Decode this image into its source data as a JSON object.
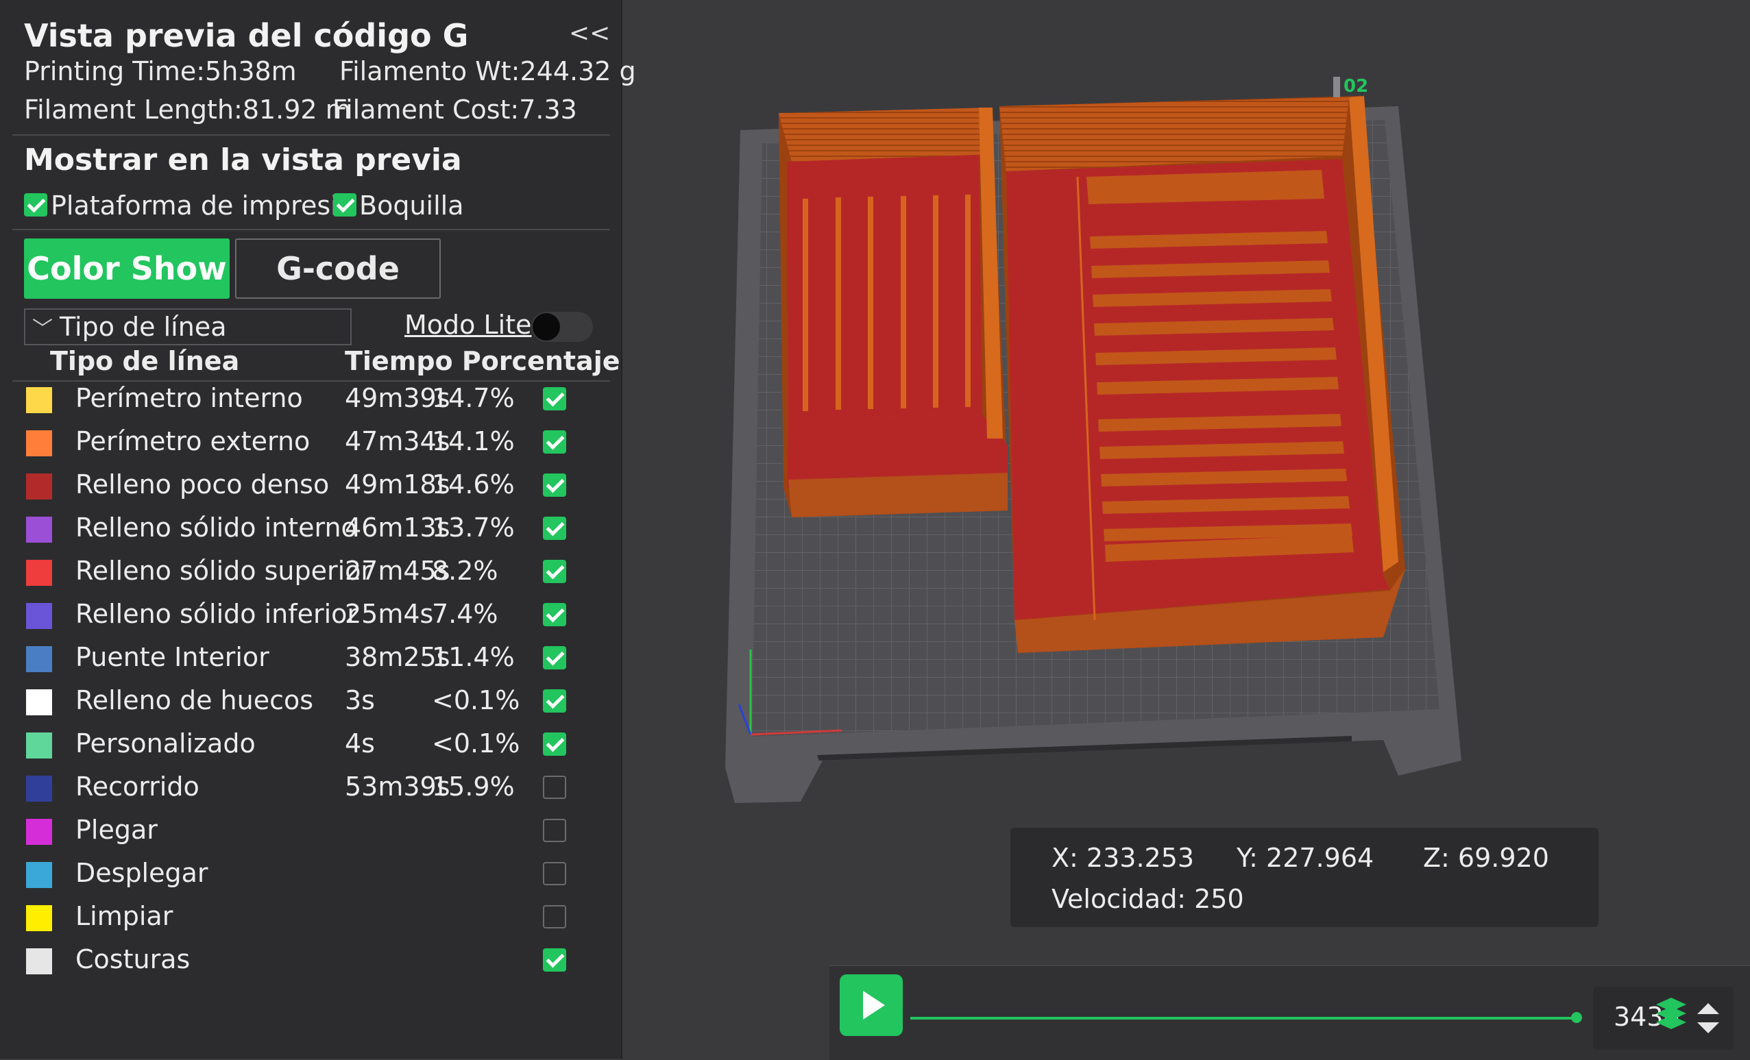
{
  "panel": {
    "title": "Vista previa del código G",
    "collapse_label": "<<",
    "printing_time": "Printing Time:5h38m",
    "filament_wt": "Filamento Wt:244.32 g",
    "filament_length": "Filament Length:81.92 m",
    "filament_cost": "Filament Cost:7.33",
    "show_title": "Mostrar en la vista previa",
    "show_options": [
      {
        "label": "Plataforma de impresió",
        "checked": true
      },
      {
        "label": "Boquilla",
        "checked": true
      }
    ],
    "buttons": {
      "color_show": "Color Show",
      "gcode": "G-code"
    },
    "view_select": "Tipo de línea",
    "lite_mode_label": "Modo Lite",
    "columns": {
      "type": "Tipo de línea",
      "time_pct": "Tiempo Porcentaje"
    },
    "line_types": [
      {
        "label": "Perímetro interno",
        "time": "49m39s",
        "percent": "14.7%",
        "color": "#ffd84a",
        "checked": true
      },
      {
        "label": "Perímetro externo",
        "time": "47m34s",
        "percent": "14.1%",
        "color": "#ff7f3a",
        "checked": true
      },
      {
        "label": "Relleno poco denso",
        "time": "49m18s",
        "percent": "14.6%",
        "color": "#b32a2a",
        "checked": true
      },
      {
        "label": "Relleno sólido interno",
        "time": "46m13s",
        "percent": "13.7%",
        "color": "#9a4fd6",
        "checked": true
      },
      {
        "label": "Relleno sólido superior",
        "time": "27m45s",
        "percent": "8.2%",
        "color": "#ef3c3c",
        "checked": true
      },
      {
        "label": "Relleno sólido inferior",
        "time": "25m4s",
        "percent": "7.4%",
        "color": "#6a55d8",
        "checked": true
      },
      {
        "label": "Puente Interior",
        "time": "38m25s",
        "percent": "11.4%",
        "color": "#4a7ec4",
        "checked": true
      },
      {
        "label": "Relleno de huecos",
        "time": "3s",
        "percent": "<0.1%",
        "color": "#ffffff",
        "checked": true
      },
      {
        "label": "Personalizado",
        "time": "4s",
        "percent": "<0.1%",
        "color": "#5fd69a",
        "checked": true
      },
      {
        "label": "Recorrido",
        "time": "53m39s",
        "percent": "15.9%",
        "color": "#2f3f9a",
        "checked": false
      },
      {
        "label": "Plegar",
        "time": "",
        "percent": "",
        "color": "#d52ed8",
        "checked": false
      },
      {
        "label": "Desplegar",
        "time": "",
        "percent": "",
        "color": "#3aa8d8",
        "checked": false
      },
      {
        "label": "Limpiar",
        "time": "",
        "percent": "",
        "color": "#ffee00",
        "checked": false
      },
      {
        "label": "Costuras",
        "time": "",
        "percent": "",
        "color": "#e6e6e6",
        "checked": true
      }
    ]
  },
  "viewport": {
    "plate_label": "02"
  },
  "coords": {
    "x": "X: 233.253",
    "y": "Y: 227.964",
    "z": "Z: 69.920",
    "speed": "Velocidad: 250"
  },
  "playback": {
    "layer_value": "3436",
    "accent": "#22c55e"
  }
}
